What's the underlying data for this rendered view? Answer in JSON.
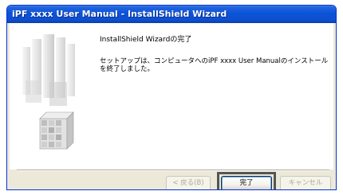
{
  "window": {
    "title": "iPF xxxx User Manual - InstallShield Wizard"
  },
  "content": {
    "heading": "InstallShield Wizardの完了",
    "message": "セットアップは、コンピュータへのiPF xxxx User Manualのインストールを終了しました。"
  },
  "buttons": {
    "back": "< 戻る(B)",
    "finish": "完了",
    "cancel": "キャンセル"
  },
  "colors": {
    "title_bar": "#0a53d8",
    "dialog_bg": "#ece9d8",
    "content_bg": "#ffffff",
    "highlight": "#555555"
  }
}
